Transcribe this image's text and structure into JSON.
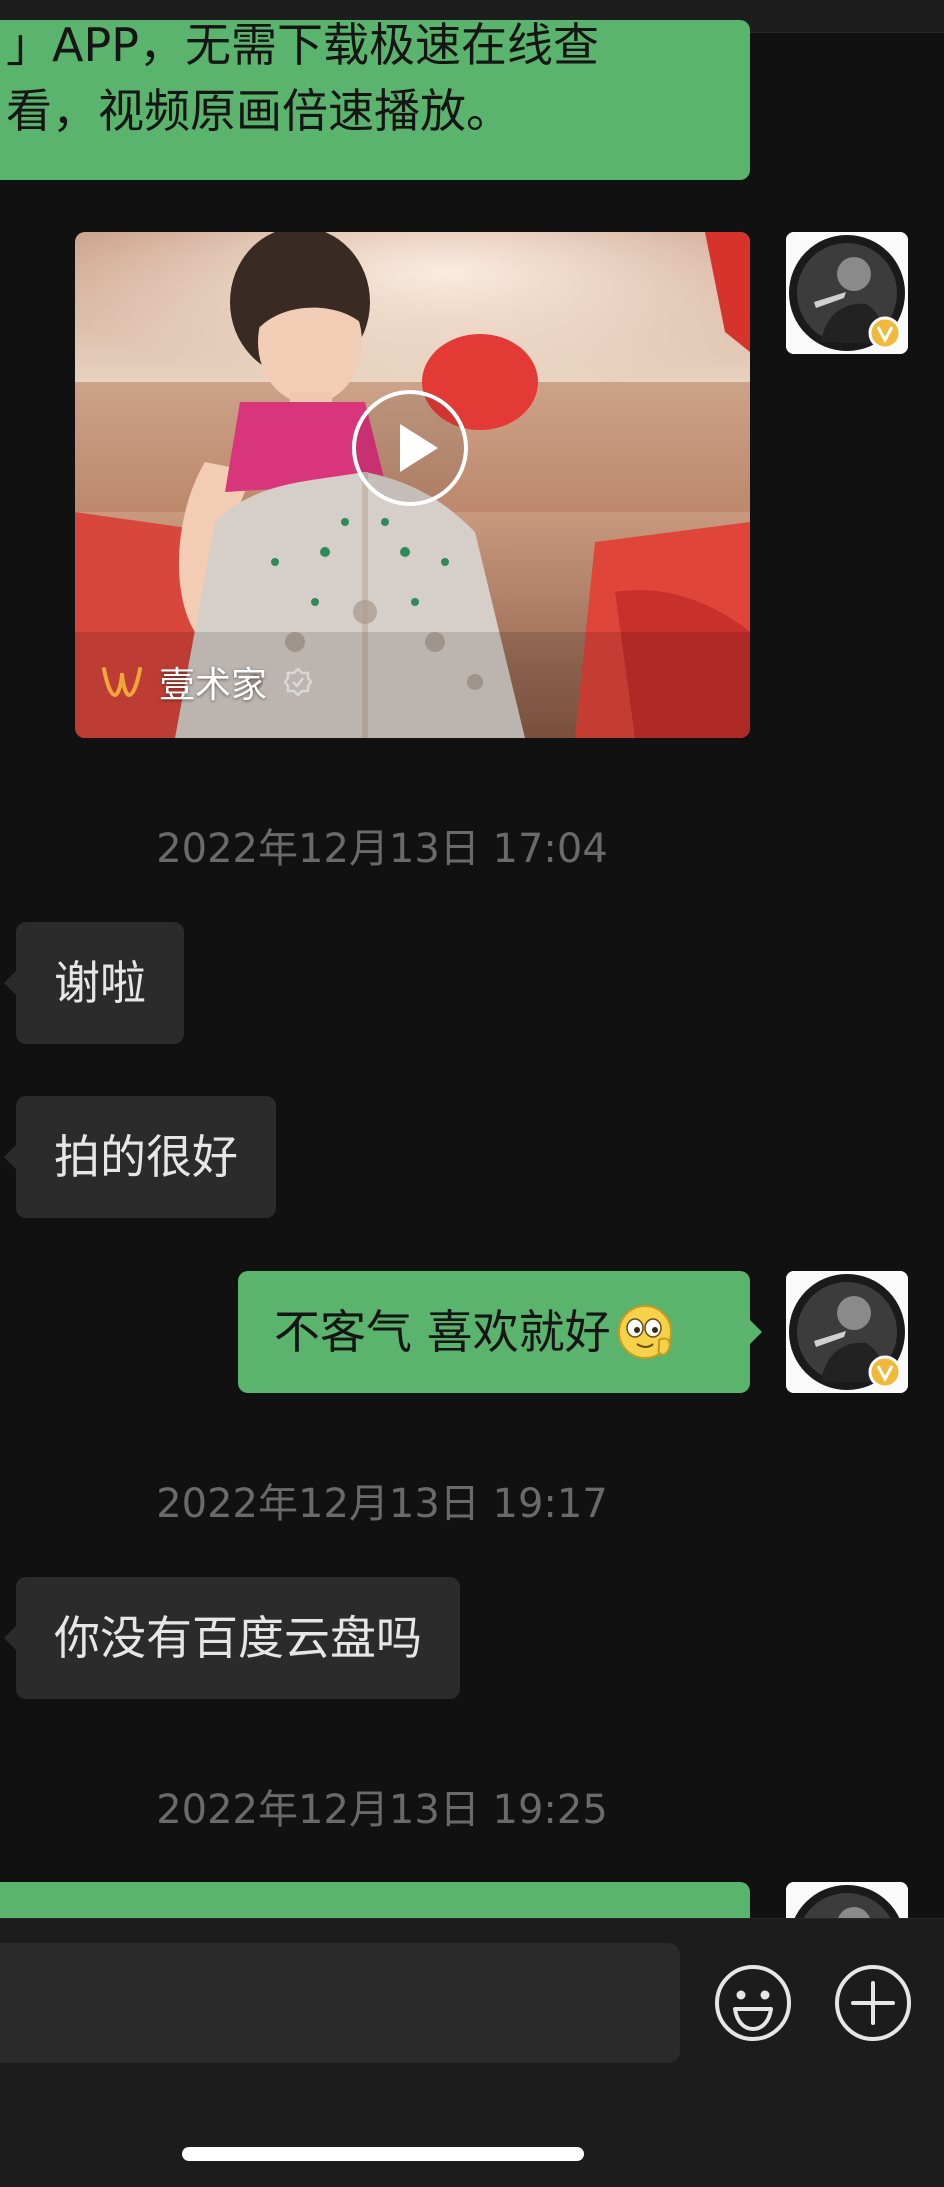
{
  "messages": {
    "top_partial": {
      "line1": "」APP，无需下载极速在线查",
      "line2": "看，视频原画倍速播放。"
    },
    "video_card": {
      "source_name": "壹术家"
    },
    "timestamps": [
      "2022年12月13日 17:04",
      "2022年12月13日 19:17",
      "2022年12月13日 19:25"
    ],
    "incoming_1": "谢啦",
    "incoming_2": "拍的很好",
    "outgoing_reply": "不客气 喜欢就好",
    "incoming_3": "你没有百度云盘吗"
  },
  "icons": {
    "emoji": "smirk-emoji-icon",
    "emoji_button": "smile-face-icon",
    "more_button": "plus-circle-icon",
    "verified": "verified-badge-icon"
  },
  "colors": {
    "background": "#111111",
    "outgoing_bubble": "#5bb46d",
    "incoming_bubble": "#2b2b2b",
    "timestamp": "#6a6a6a",
    "verified_badge": "#f1b93a",
    "input_bar": "#1c1c1c"
  }
}
